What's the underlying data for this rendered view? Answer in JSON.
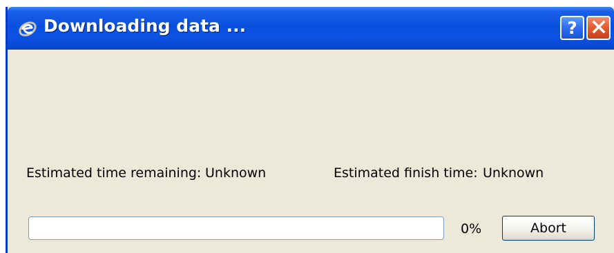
{
  "window": {
    "title": "Downloading data ...",
    "help_label": "?",
    "close_icon": "close-icon",
    "app_icon": "app-logo-icon"
  },
  "info": {
    "time_remaining_label": "Estimated time remaining:",
    "time_remaining_value": "Unknown",
    "finish_time_label": "Estimated finish time:",
    "finish_time_value": "Unknown"
  },
  "progress": {
    "value": 0,
    "text": "0%"
  },
  "buttons": {
    "abort": "Abort"
  },
  "colors": {
    "titlebar": "#0A50E0",
    "dialog_bg": "#ECE9D8",
    "close_button": "#E25A2E",
    "help_button": "#2C6CF0"
  }
}
